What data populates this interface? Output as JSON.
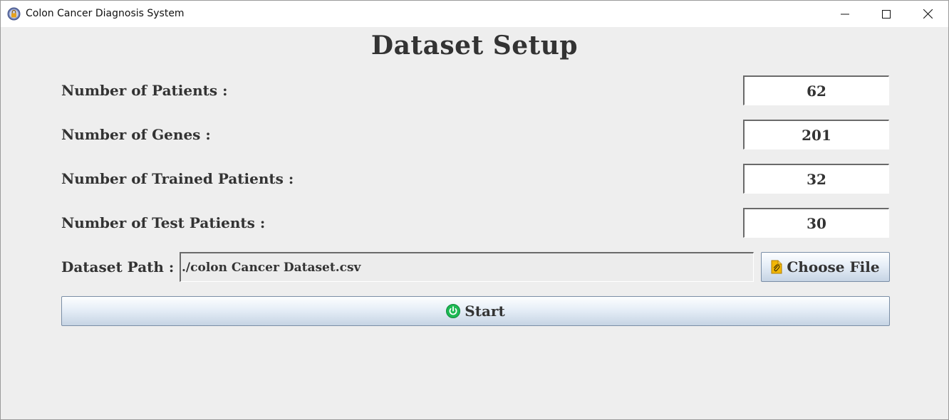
{
  "window": {
    "title": "Colon Cancer Diagnosis System",
    "icon": "app-lock-icon",
    "controls": [
      "minimize-icon",
      "maximize-icon",
      "close-icon"
    ]
  },
  "page": {
    "heading": "Dataset Setup"
  },
  "form": {
    "patients": {
      "label": "Number of Patients :",
      "value": "62"
    },
    "genes": {
      "label": "Number of Genes :",
      "value": "201"
    },
    "trained": {
      "label": "Number of Trained Patients :",
      "value": "32"
    },
    "test": {
      "label": "Number of Test Patients :",
      "value": "30"
    },
    "path": {
      "label": "Dataset Path :",
      "value": "./colon Cancer Dataset.csv"
    }
  },
  "buttons": {
    "choose_file": {
      "label": "Choose File",
      "icon": "attachment-file-icon"
    },
    "start": {
      "label": "Start",
      "icon": "power-icon"
    }
  },
  "colors": {
    "background": "#eeeeee",
    "text": "#333333",
    "button_border": "#7a8ea6",
    "power_icon": "#1db954",
    "file_icon": "#f2b705"
  }
}
